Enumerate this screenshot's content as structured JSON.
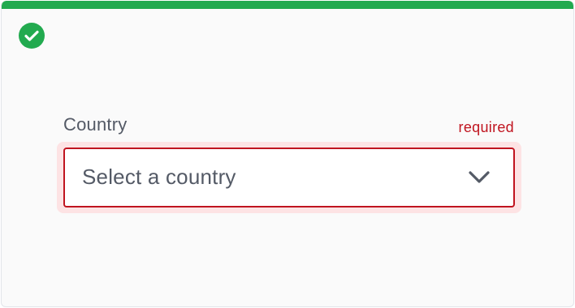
{
  "status": {
    "icon": "check-circle-icon",
    "color": "#22aa4f"
  },
  "field": {
    "label": "Country",
    "required_text": "required",
    "placeholder": "Select a country",
    "chevron_icon": "chevron-down-icon",
    "error_color": "#c0141f"
  }
}
